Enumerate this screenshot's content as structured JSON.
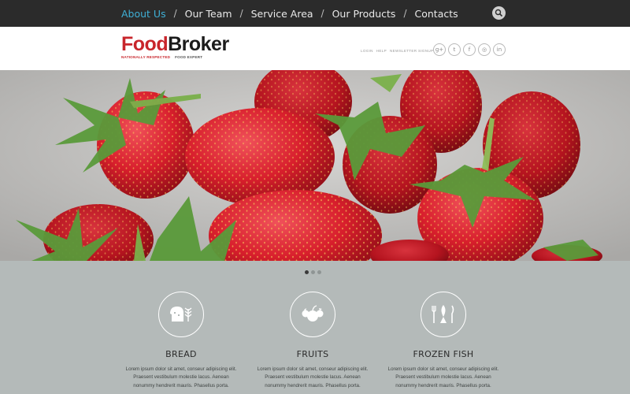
{
  "nav": {
    "items": [
      {
        "label": "About Us"
      },
      {
        "label": "Our Team"
      },
      {
        "label": "Service Area"
      },
      {
        "label": "Our Products"
      },
      {
        "label": "Contacts"
      }
    ],
    "separator": "/",
    "search_icon": "search-icon"
  },
  "header": {
    "logo_food": "Food",
    "logo_broker": "Broker",
    "tagline_1": "NATIONALLY RESPECTED",
    "tagline_2": "FOOD EXPERT",
    "utility": [
      "LOGIN",
      "HELP",
      "NEWSLETTER SIGNUP"
    ],
    "social": [
      {
        "icon": "google-plus-icon",
        "glyph": "g+"
      },
      {
        "icon": "twitter-icon",
        "glyph": "t"
      },
      {
        "icon": "facebook-icon",
        "glyph": "f"
      },
      {
        "icon": "instagram-icon",
        "glyph": "◎"
      },
      {
        "icon": "linkedin-icon",
        "glyph": "in"
      }
    ]
  },
  "slider": {
    "total_slides": 3,
    "active_index": 0
  },
  "features": [
    {
      "title": "BREAD",
      "icon": "bread-icon",
      "text": "Lorem ipsum dolor sit amet, conseur adipiscing elit. Praesent vestibulum molestie lacus. Aenean nonummy hendrerit mauris. Phasellus porta."
    },
    {
      "title": "FRUITS",
      "icon": "fruits-icon",
      "text": "Lorem ipsum dolor sit amet, conseur adipiscing elit. Praesent vestibulum molestie lacus. Aenean nonummy hendrerit mauris. Phasellus porta."
    },
    {
      "title": "FROZEN FISH",
      "icon": "fish-icon",
      "text": "Lorem ipsum dolor sit amet, conseur adipiscing elit. Praesent vestibulum molestie lacus. Aenean nonummy hendrerit mauris. Phasellus porta."
    }
  ],
  "colors": {
    "topbar": "#2b2b2b",
    "active_link": "#3fb0d6",
    "brand_red": "#c8252b",
    "section_bg": "#b4bab9"
  }
}
